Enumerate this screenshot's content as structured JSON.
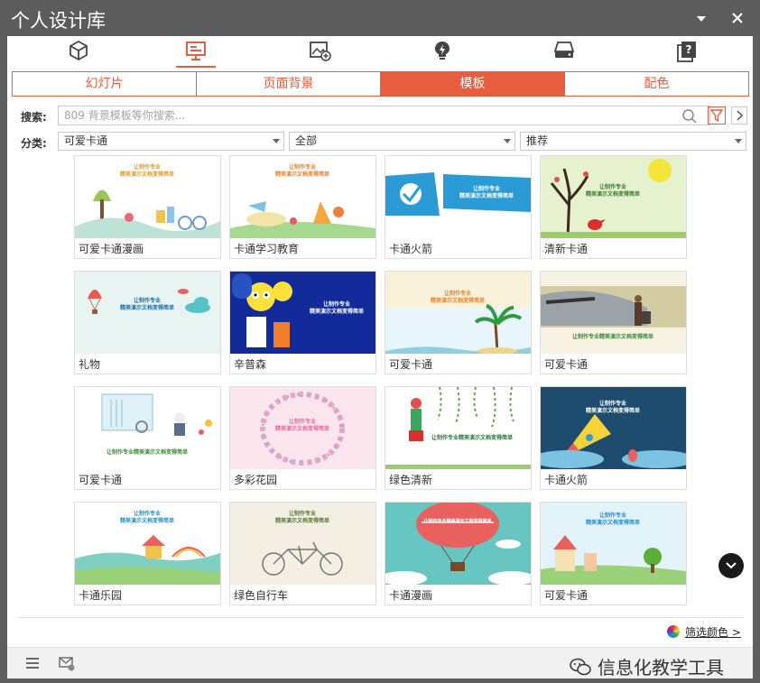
{
  "window": {
    "title": "个人设计库"
  },
  "toolbar_icons": [
    {
      "name": "cube-icon"
    },
    {
      "name": "presentation-icon",
      "active": true
    },
    {
      "name": "image-add-icon"
    },
    {
      "name": "bulb-icon"
    },
    {
      "name": "drive-icon"
    },
    {
      "name": "help-icon"
    }
  ],
  "tabs": [
    {
      "label": "幻灯片"
    },
    {
      "label": "页面背景"
    },
    {
      "label": "模板",
      "active": true
    },
    {
      "label": "配色"
    }
  ],
  "search": {
    "label": "搜索:",
    "placeholder": "809 背景模板等你搜索..."
  },
  "category": {
    "label": "分类:",
    "select1": "可爱卡通",
    "select2": "全部",
    "select3": "推荐"
  },
  "templates": [
    {
      "caption": "可爱卡通漫画",
      "theme": "cartoon-city"
    },
    {
      "caption": "卡通学习教育",
      "theme": "education"
    },
    {
      "caption": "卡通火箭",
      "theme": "blue-banner"
    },
    {
      "caption": "清新卡通",
      "theme": "tree-bird"
    },
    {
      "caption": "礼物",
      "theme": "balloon-clouds"
    },
    {
      "caption": "辛普森",
      "theme": "simpsons"
    },
    {
      "caption": "可爱卡通",
      "theme": "beach"
    },
    {
      "caption": "可爱卡通",
      "theme": "train"
    },
    {
      "caption": "可爱卡通",
      "theme": "book"
    },
    {
      "caption": "多彩花园",
      "theme": "flower-wreath"
    },
    {
      "caption": "绿色清新",
      "theme": "vines"
    },
    {
      "caption": "卡通火箭",
      "theme": "rocket"
    },
    {
      "caption": "卡通乐园",
      "theme": "park"
    },
    {
      "caption": "绿色自行车",
      "theme": "bicycle"
    },
    {
      "caption": "卡通漫画",
      "theme": "hot-air-balloon"
    },
    {
      "caption": "可爱卡通",
      "theme": "castle"
    }
  ],
  "thumb_text": {
    "line1": "让制作专业",
    "line2": "精美演示文档变得简单"
  },
  "footer": {
    "filter_color": "筛选颜色 >",
    "watermark": "信息化教学工具"
  },
  "colors": {
    "accent": "#e65d3f"
  }
}
